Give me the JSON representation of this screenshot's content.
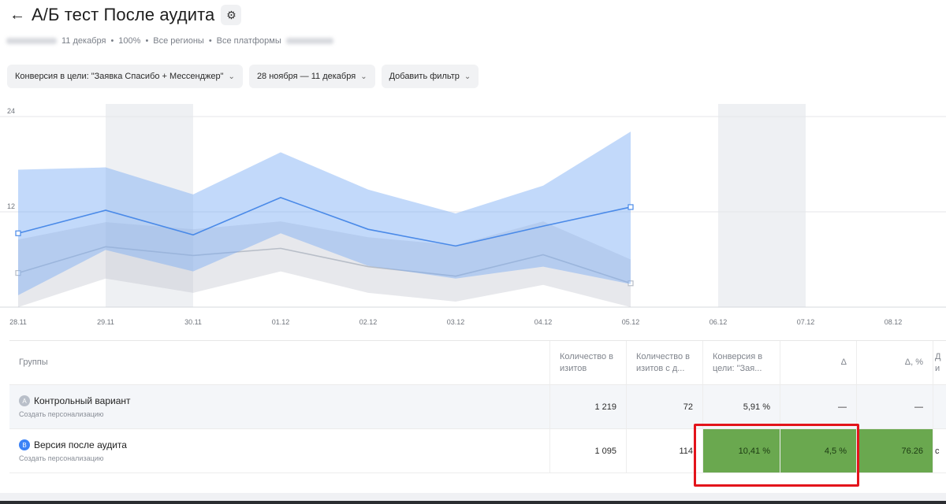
{
  "header": {
    "title": "А/Б тест После аудита",
    "back_glyph": "←",
    "settings_glyph": "⚙"
  },
  "meta": {
    "date": "11 декабря",
    "percent": "100%",
    "regions": "Все регионы",
    "platforms": "Все платформы",
    "sep": "•"
  },
  "filters": [
    {
      "label": "Конверсия в цели: \"Заявка Спасибо + Мессенджер\""
    },
    {
      "label": "28 ноября — 11 декабря"
    },
    {
      "label": "Добавить фильтр"
    }
  ],
  "chart_data": {
    "type": "line",
    "x": [
      "28.11",
      "29.11",
      "30.11",
      "01.12",
      "02.12",
      "03.12",
      "04.12",
      "05.12",
      "06.12",
      "07.12",
      "08.12"
    ],
    "yticks": [
      12,
      24
    ],
    "ylim": [
      0,
      24
    ],
    "series": [
      {
        "color": "#4a8ae8",
        "values": [
          9.3,
          12.2,
          9.1,
          13.8,
          9.8,
          7.7,
          10.2,
          12.6,
          null,
          null,
          null
        ],
        "upper": [
          17.3,
          17.6,
          14.2,
          19.5,
          14.8,
          11.8,
          15.3,
          22.1,
          null,
          null,
          null
        ],
        "lower": [
          1.5,
          7.2,
          4.5,
          9.3,
          5.2,
          3.6,
          5.1,
          2.9,
          null,
          null,
          null
        ]
      },
      {
        "color": "#b8bec8",
        "values": [
          4.3,
          7.6,
          6.5,
          7.4,
          5.1,
          3.9,
          6.6,
          3.0,
          null,
          null,
          null
        ],
        "upper": [
          8.5,
          10.7,
          9.8,
          10.8,
          8.8,
          7.8,
          10.8,
          6.0,
          null,
          null,
          null
        ],
        "lower": [
          0.0,
          3.6,
          1.8,
          4.5,
          1.8,
          0.7,
          2.8,
          0.0,
          null,
          null,
          null
        ]
      }
    ],
    "shaded_x": [
      "29.11",
      "30.11",
      "06.12",
      "07.12"
    ]
  },
  "table": {
    "headers": [
      "Группы",
      "Количество в изитов",
      "Количество в изитов с д...",
      "Конверсия в цели: \"Зая...",
      "Δ",
      "Δ, %",
      "Д и"
    ],
    "rows": [
      {
        "badge": "A",
        "name": "Контрольный вариант",
        "sub": "Создать персонализацию",
        "visits": "1 219",
        "visits_goal": "72",
        "conversion": "5,91 %",
        "delta": "—",
        "delta_pct": "—",
        "extra": ""
      },
      {
        "badge": "B",
        "name": "Версия после аудита",
        "sub": "Создать персонализацию",
        "visits": "1 095",
        "visits_goal": "114",
        "conversion": "10,41 %",
        "delta": "4,5 %",
        "delta_pct": "76.26",
        "extra": "c"
      }
    ]
  }
}
